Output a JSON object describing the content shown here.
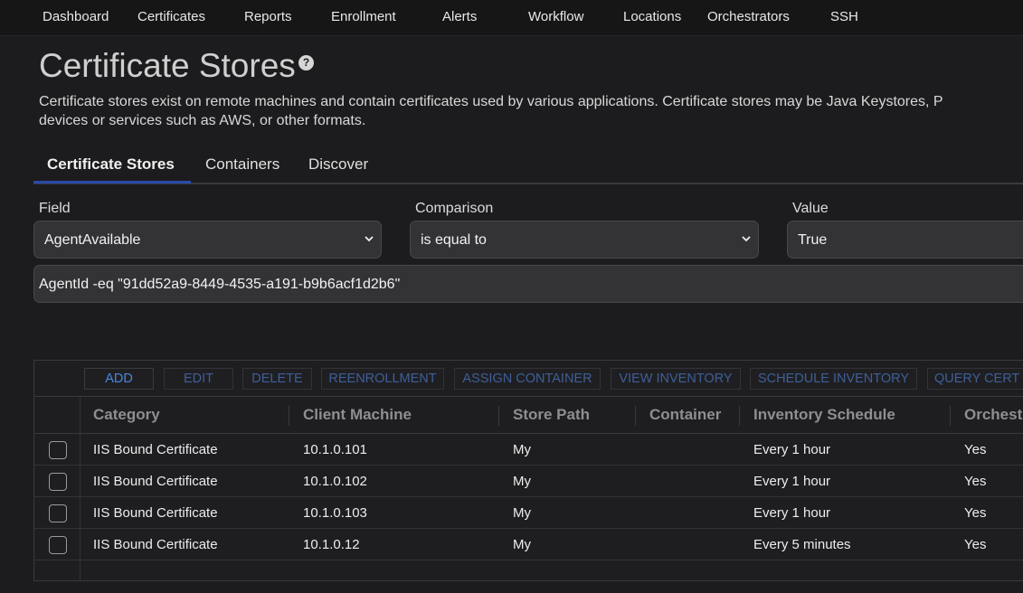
{
  "nav": [
    "Dashboard",
    "Certificates",
    "Reports",
    "Enrollment",
    "Alerts",
    "Workflow",
    "Locations",
    "Orchestrators",
    "SSH"
  ],
  "page": {
    "title": "Certificate Stores",
    "help": "?",
    "description_line1": "Certificate stores exist on remote machines and contain certificates used by various applications. Certificate stores may be Java Keystores, P",
    "description_line2": "devices or services such as AWS, or other formats."
  },
  "tabs": [
    "Certificate Stores",
    "Containers",
    "Discover"
  ],
  "filter": {
    "field_label": "Field",
    "field_value": "AgentAvailable",
    "comparison_label": "Comparison",
    "comparison_value": "is equal to",
    "value_label": "Value",
    "value_value": "True",
    "query": "AgentId -eq \"91dd52a9-8449-4535-a191-b9b6acf1d2b6\""
  },
  "toolbar": [
    "ADD",
    "EDIT",
    "DELETE",
    "REENROLLMENT",
    "ASSIGN CONTAINER",
    "VIEW INVENTORY",
    "SCHEDULE INVENTORY",
    "QUERY CERT"
  ],
  "columns": [
    "Category",
    "Client Machine",
    "Store Path",
    "Container",
    "Inventory Schedule",
    "Orchest"
  ],
  "rows": [
    {
      "category": "IIS Bound Certificate",
      "client": "10.1.0.101",
      "path": "My",
      "container": "",
      "schedule": "Every 1 hour",
      "orch": "Yes"
    },
    {
      "category": "IIS Bound Certificate",
      "client": "10.1.0.102",
      "path": "My",
      "container": "",
      "schedule": "Every 1 hour",
      "orch": "Yes"
    },
    {
      "category": "IIS Bound Certificate",
      "client": "10.1.0.103",
      "path": "My",
      "container": "",
      "schedule": "Every 1 hour",
      "orch": "Yes"
    },
    {
      "category": "IIS Bound Certificate",
      "client": "10.1.0.12",
      "path": "My",
      "container": "",
      "schedule": "Every 5 minutes",
      "orch": "Yes"
    }
  ],
  "colors": {
    "accent": "#2a4aa8",
    "link": "#4b86e0"
  }
}
